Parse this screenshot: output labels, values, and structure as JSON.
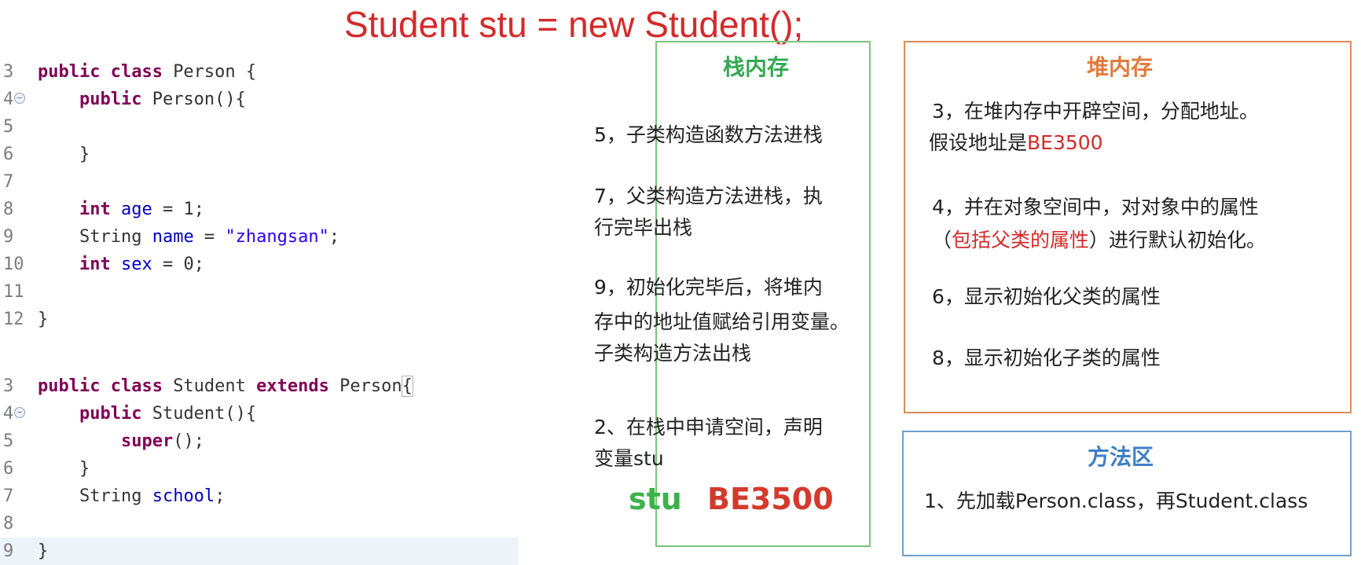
{
  "title": "Student stu = new Student();",
  "person_code": [
    {
      "n": "3",
      "fold": false,
      "segs": [
        [
          "kw",
          "public class "
        ],
        [
          "",
          "Person {"
        ]
      ]
    },
    {
      "n": "4",
      "fold": true,
      "segs": [
        [
          "",
          "    "
        ],
        [
          "kw",
          "public "
        ],
        [
          "",
          "Person(){"
        ]
      ]
    },
    {
      "n": "5",
      "fold": false,
      "segs": [
        [
          "",
          ""
        ]
      ]
    },
    {
      "n": "6",
      "fold": false,
      "segs": [
        [
          "",
          "    }"
        ]
      ]
    },
    {
      "n": "7",
      "fold": false,
      "segs": [
        [
          "",
          ""
        ]
      ]
    },
    {
      "n": "8",
      "fold": false,
      "segs": [
        [
          "",
          "    "
        ],
        [
          "kw",
          "int "
        ],
        [
          "fld",
          "age"
        ],
        [
          "",
          " = 1;"
        ]
      ]
    },
    {
      "n": "9",
      "fold": false,
      "segs": [
        [
          "",
          "    String "
        ],
        [
          "fld",
          "name"
        ],
        [
          "",
          " = "
        ],
        [
          "str",
          "\"zhangsan\""
        ],
        [
          "",
          ";"
        ]
      ]
    },
    {
      "n": "10",
      "fold": false,
      "segs": [
        [
          "",
          "    "
        ],
        [
          "kw",
          "int "
        ],
        [
          "fld",
          "sex"
        ],
        [
          "",
          " = 0;"
        ]
      ]
    },
    {
      "n": "11",
      "fold": false,
      "segs": [
        [
          "",
          ""
        ]
      ]
    },
    {
      "n": "12",
      "fold": false,
      "segs": [
        [
          "",
          "}"
        ]
      ]
    }
  ],
  "student_code": [
    {
      "n": "3",
      "fold": false,
      "segs": [
        [
          "kw",
          "public class "
        ],
        [
          "",
          "Student "
        ],
        [
          "kw",
          "extends "
        ],
        [
          "",
          "Person"
        ],
        [
          "bracket",
          "{"
        ]
      ]
    },
    {
      "n": "4",
      "fold": true,
      "segs": [
        [
          "",
          "    "
        ],
        [
          "kw",
          "public "
        ],
        [
          "",
          "Student(){"
        ]
      ]
    },
    {
      "n": "5",
      "fold": false,
      "segs": [
        [
          "",
          "        "
        ],
        [
          "kw",
          "super"
        ],
        [
          "",
          "();"
        ]
      ]
    },
    {
      "n": "6",
      "fold": false,
      "segs": [
        [
          "",
          "    }"
        ]
      ]
    },
    {
      "n": "7",
      "fold": false,
      "segs": [
        [
          "",
          "    String "
        ],
        [
          "fld",
          "school"
        ],
        [
          "",
          ";"
        ]
      ]
    },
    {
      "n": "8",
      "fold": false,
      "segs": [
        [
          "",
          ""
        ]
      ]
    },
    {
      "n": "9",
      "fold": false,
      "hl": true,
      "segs": [
        [
          "",
          "}"
        ]
      ]
    }
  ],
  "stack": {
    "title": "栈内存",
    "step5": "5，子类构造函数方法进栈",
    "step7_l1": "7，父类构造方法进栈，执",
    "step7_l2": "行完毕出栈",
    "step9_l1": "9，初始化完毕后，将堆内",
    "step9_l2": "存中的地址值赋给引用变量。",
    "step9_l3": "子类构造方法出栈",
    "step2_l1": "2、在栈中申请空间，声明",
    "step2_l2": "变量stu",
    "var_name": "stu",
    "var_value": "BE3500"
  },
  "heap": {
    "title": "堆内存",
    "step3_l1": "3，在堆内存中开辟空间，分配地址。",
    "step3_l2_pre": "假设地址是",
    "step3_l2_addr": "BE3500",
    "step4_l1": "4，并在对象空间中，对对象中的属性",
    "step4_l2_open": "（",
    "step4_l2_red": "包括父类的属性",
    "step4_l2_rest": "）进行默认初始化。",
    "step6": "6，显示初始化父类的属性",
    "step8": "8，显示初始化子类的属性"
  },
  "method_area": {
    "title": "方法区",
    "step1": "1、先加载Person.class，再Student.class"
  }
}
